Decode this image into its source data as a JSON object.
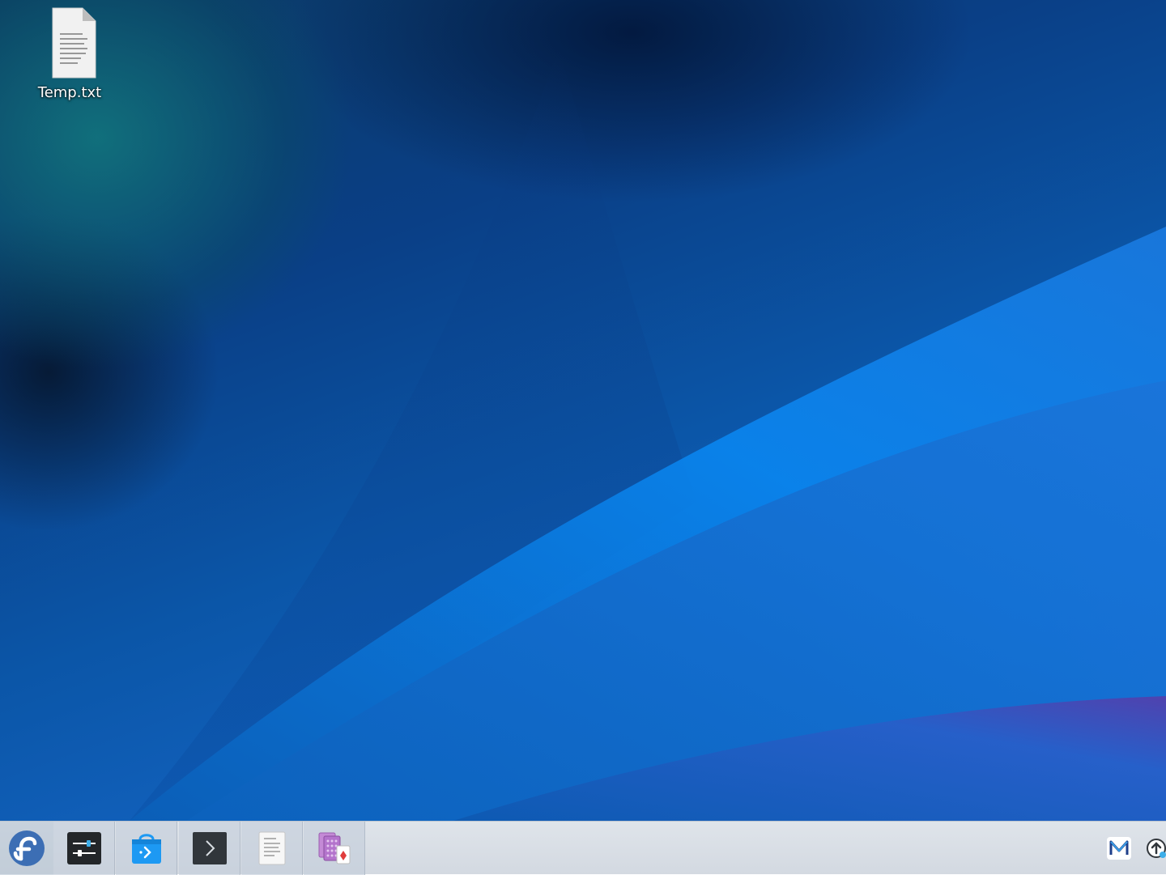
{
  "desktop": {
    "icons": [
      {
        "label": "Temp.txt",
        "icon": "text-file-icon"
      }
    ]
  },
  "taskbar": {
    "launcher": {
      "icon": "fedora-logo-icon"
    },
    "apps": [
      {
        "icon": "system-settings-icon"
      },
      {
        "icon": "software-center-icon"
      },
      {
        "icon": "terminal-icon"
      },
      {
        "icon": "text-editor-icon"
      },
      {
        "icon": "solitaire-cards-icon"
      }
    ],
    "tray": [
      {
        "icon": "mail-icon"
      },
      {
        "icon": "update-notifier-icon"
      }
    ]
  },
  "colors": {
    "fedora_blue": "#3c6eb4",
    "taskbar_bg": "#dfe4ea"
  }
}
